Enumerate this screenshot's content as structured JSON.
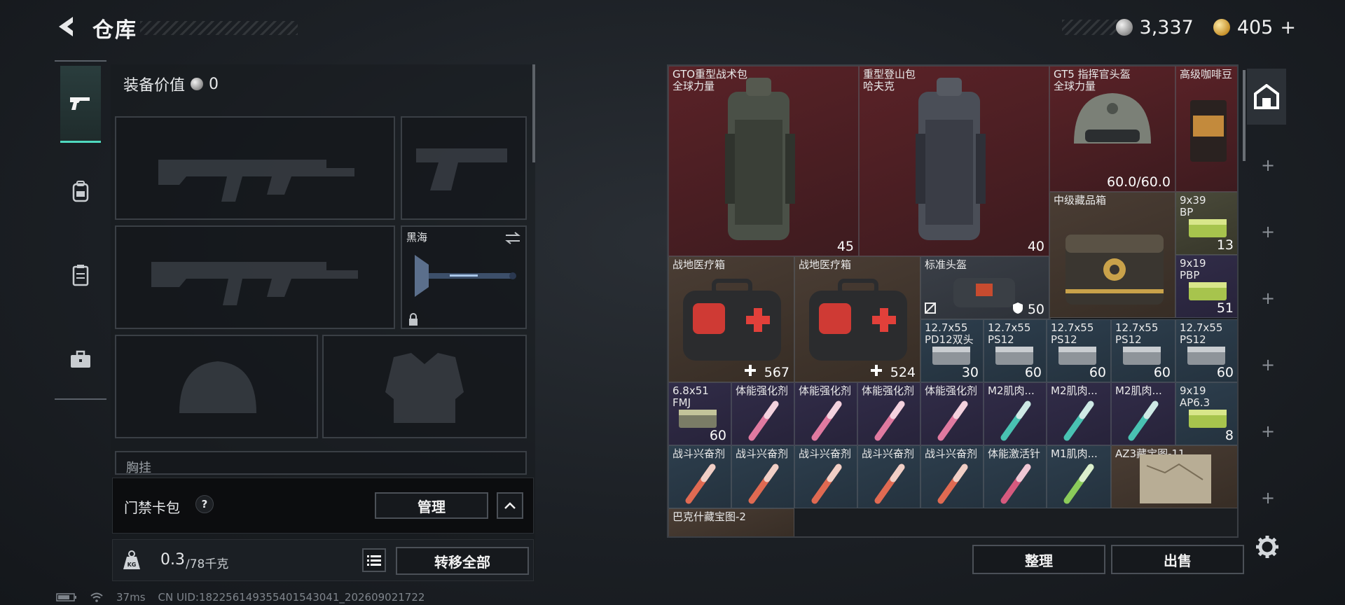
{
  "header": {
    "title": "仓库",
    "silver_amount": "3,337",
    "gold_amount": "405",
    "gold_plus": "+"
  },
  "tabs": [
    {
      "name": "weapons",
      "icon": "gun-icon",
      "active": true
    },
    {
      "name": "backpack",
      "icon": "backpack-icon",
      "active": false
    },
    {
      "name": "vest",
      "icon": "vest-icon",
      "active": false
    },
    {
      "name": "case",
      "icon": "briefcase-icon",
      "active": false
    }
  ],
  "equipment": {
    "value_label": "装备价值",
    "value": "0",
    "melee_name": "黑海",
    "chest_rig_label": "胸挂"
  },
  "access_card": {
    "label": "门禁卡包",
    "help": "?",
    "manage_label": "管理"
  },
  "weight": {
    "current": "0.3",
    "max": "/78千克",
    "icon_label": "KG",
    "transfer_all_label": "转移全部"
  },
  "storage": {
    "items": [
      {
        "id": "tactical-backpack",
        "name": "GTO重型战术包\n全球力量",
        "count": "45",
        "count_icon": "bag"
      },
      {
        "id": "mountain-backpack",
        "name": "重型登山包\n哈夫克",
        "count": "40",
        "count_icon": "bag"
      },
      {
        "id": "commander-helmet",
        "name": "GT5 指挥官头盔\n全球力量",
        "count": "60.0/60.0"
      },
      {
        "id": "coffee",
        "name": "高级咖啡豆",
        "count": ""
      },
      {
        "id": "mid-box",
        "name": "中级藏品箱",
        "count": ""
      },
      {
        "id": "ammo-9x39",
        "name": "9x39\nBP",
        "count": "13"
      },
      {
        "id": "med1",
        "name": "战地医疗箱",
        "count": "567"
      },
      {
        "id": "med2",
        "name": "战地医疗箱",
        "count": "524"
      },
      {
        "id": "std-helmet",
        "name": "标准头盔",
        "count": "50"
      },
      {
        "id": "ammo-9x19-pbp",
        "name": "9x19\nPBP",
        "count": "51"
      },
      {
        "id": "a1",
        "name": "12.7x55\nPD12双头",
        "count": "30"
      },
      {
        "id": "a2",
        "name": "12.7x55\nPS12",
        "count": "60"
      },
      {
        "id": "a3",
        "name": "12.7x55\nPS12",
        "count": "60"
      },
      {
        "id": "a4",
        "name": "12.7x55\nPS12",
        "count": "60"
      },
      {
        "id": "a5",
        "name": "12.7x55\nPS12",
        "count": "60"
      },
      {
        "id": "ammo-68",
        "name": "6.8x51\nFMJ",
        "count": "60"
      },
      {
        "id": "s1",
        "name": "体能强化剂",
        "count": ""
      },
      {
        "id": "s2",
        "name": "体能强化剂",
        "count": ""
      },
      {
        "id": "s3",
        "name": "体能强化剂",
        "count": ""
      },
      {
        "id": "s4",
        "name": "体能强化剂",
        "count": ""
      },
      {
        "id": "m1",
        "name": "M2肌肉...",
        "count": ""
      },
      {
        "id": "m2",
        "name": "M2肌肉...",
        "count": ""
      },
      {
        "id": "m3",
        "name": "M2肌肉...",
        "count": ""
      },
      {
        "id": "ammo-919-ap",
        "name": "9x19\nAP6.3",
        "count": "8"
      },
      {
        "id": "c1",
        "name": "战斗兴奋剂",
        "count": ""
      },
      {
        "id": "c2",
        "name": "战斗兴奋剂",
        "count": ""
      },
      {
        "id": "c3",
        "name": "战斗兴奋剂",
        "count": ""
      },
      {
        "id": "c4",
        "name": "战斗兴奋剂",
        "count": ""
      },
      {
        "id": "c5",
        "name": "战斗兴奋剂",
        "count": ""
      },
      {
        "id": "inj",
        "name": "体能激活针",
        "count": ""
      },
      {
        "id": "m1b",
        "name": "M1肌肉...",
        "count": ""
      },
      {
        "id": "map-az3",
        "name": "AZ3藏宝图-11",
        "count": ""
      },
      {
        "id": "map-bk",
        "name": "巴克什藏宝图-2",
        "count": ""
      }
    ],
    "sort_label": "整理",
    "sell_label": "出售"
  },
  "status_bar": {
    "ping": "37ms",
    "uid": "CN UID:1822561493554015430​41_202609021722"
  }
}
